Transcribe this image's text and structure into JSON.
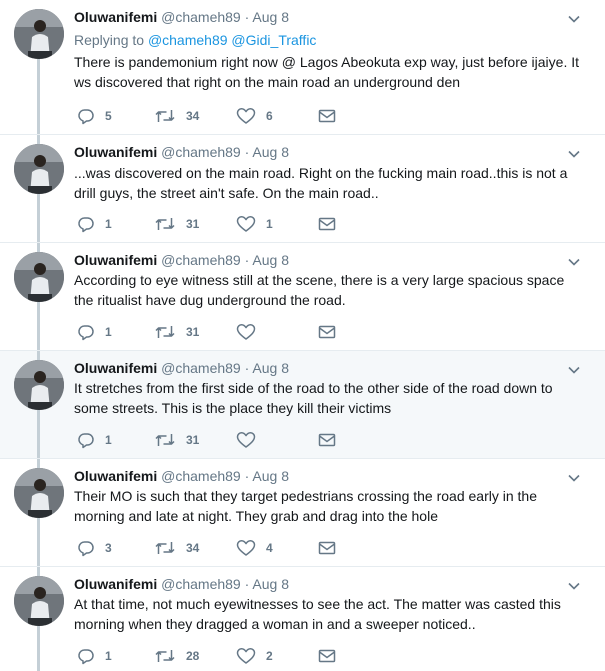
{
  "tweets": [
    {
      "name": "Oluwanifemi",
      "handle": "@chameh89",
      "date": "Aug 8",
      "replying_prefix": "Replying to",
      "replying_to": "@chameh89 @Gidi_Traffic",
      "text": "There is pandemonium right now @ Lagos Abeokuta exp way, just before ijaiye. It ws discovered that right on the main road an underground den",
      "replies": "5",
      "retweets": "34",
      "likes": "6"
    },
    {
      "name": "Oluwanifemi",
      "handle": "@chameh89",
      "date": "Aug 8",
      "text": "...was discovered on the main road. Right on the fucking main road..this is not a drill guys, the street ain't safe. On the main road..",
      "replies": "1",
      "retweets": "31",
      "likes": "1"
    },
    {
      "name": "Oluwanifemi",
      "handle": "@chameh89",
      "date": "Aug 8",
      "text": "According to eye witness still at the scene, there is a very large spacious space the ritualist have dug underground the road.",
      "replies": "1",
      "retweets": "31",
      "likes": ""
    },
    {
      "name": "Oluwanifemi",
      "handle": "@chameh89",
      "date": "Aug 8",
      "text": "It stretches from the first side of the road to the other side of the road down to some streets. This is the place they kill their victims",
      "replies": "1",
      "retweets": "31",
      "likes": ""
    },
    {
      "name": "Oluwanifemi",
      "handle": "@chameh89",
      "date": "Aug 8",
      "text": "Their MO is such that they target pedestrians crossing the road early in the morning and late at night. They grab and drag into the hole",
      "replies": "3",
      "retweets": "34",
      "likes": "4"
    },
    {
      "name": "Oluwanifemi",
      "handle": "@chameh89",
      "date": "Aug 8",
      "text": "At that time, not much eyewitnesses to see the act. The matter was casted this morning when they dragged a woman in and a sweeper noticed..",
      "replies": "1",
      "retweets": "28",
      "likes": "2"
    }
  ]
}
